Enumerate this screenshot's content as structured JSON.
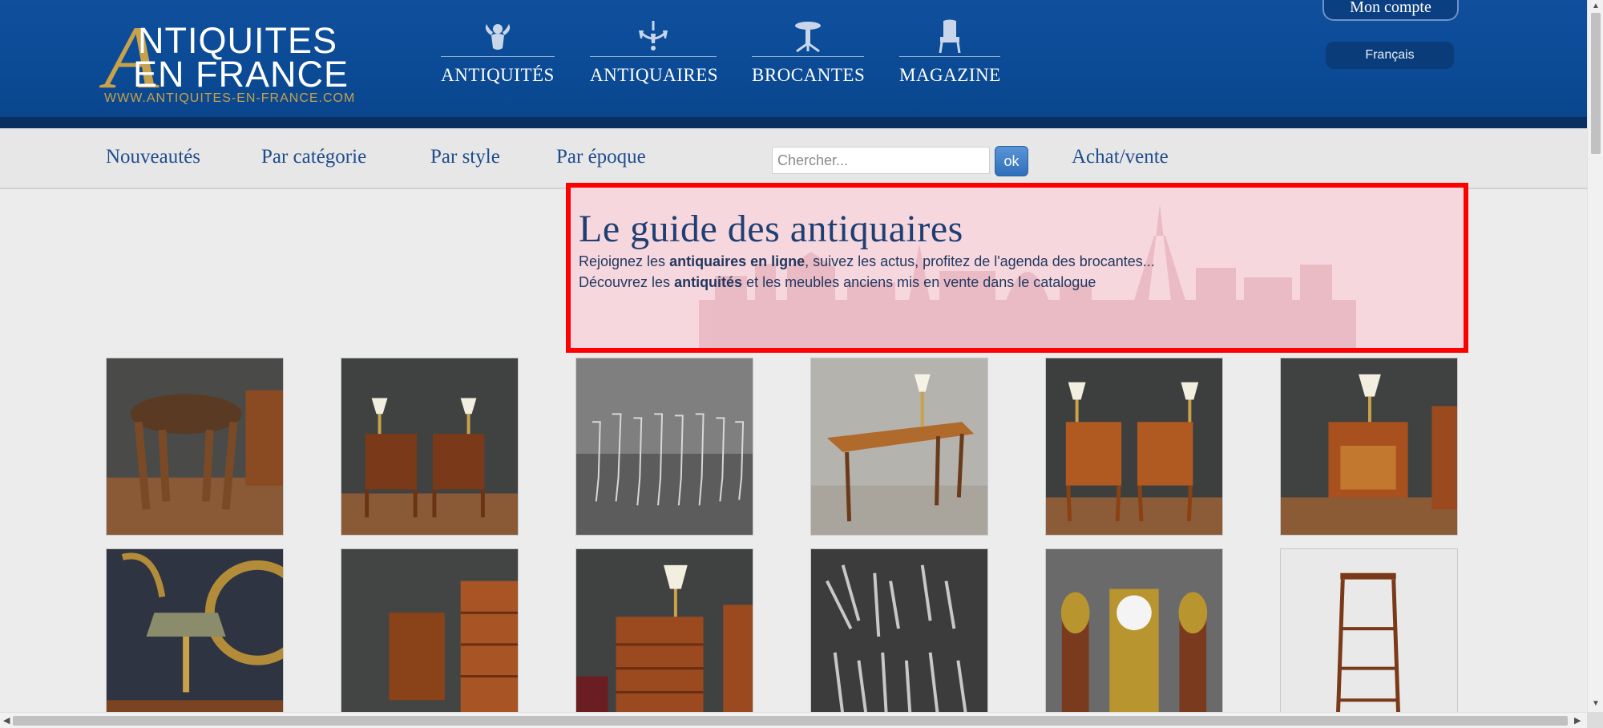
{
  "logo": {
    "line1": "NTIQUITES",
    "line2": "EN FRANCE",
    "big_letter": "A",
    "url": "WWW.ANTIQUITES-EN-FRANCE.COM"
  },
  "main_nav": [
    {
      "label": "ANTIQUITÉS",
      "icon": "cherub-icon"
    },
    {
      "label": "ANTIQUAIRES",
      "icon": "chandelier-icon"
    },
    {
      "label": "BROCANTES",
      "icon": "pedestal-table-icon"
    },
    {
      "label": "MAGAZINE",
      "icon": "armchair-icon"
    }
  ],
  "account": {
    "label": "Mon compte"
  },
  "language": {
    "label": "Français"
  },
  "subnav": [
    {
      "label": "Nouveautés"
    },
    {
      "label": "Par catégorie"
    },
    {
      "label": "Par style"
    },
    {
      "label": "Par époque"
    }
  ],
  "search": {
    "placeholder": "Chercher...",
    "value": "",
    "button": "ok"
  },
  "buy_sell": {
    "label": "Achat/vente"
  },
  "hero": {
    "title": "Le guide des antiquaires",
    "line1_pre": "Rejoignez les ",
    "line1_bold": "antiquaires en ligne",
    "line1_post": ", suivez les actus, profitez de l'agenda des brocantes...",
    "line2_pre": "Découvrez les ",
    "line2_bold": "antiquités",
    "line2_post": " et les meubles anciens mis en vente dans le catalogue"
  },
  "colors": {
    "header_blue": "#0b4a95",
    "gold": "#c7a24a",
    "subnav_text": "#1f4d8c",
    "highlight_border": "#ff0000"
  },
  "products": [
    {
      "subject": "stool"
    },
    {
      "subject": "pair-of-bedside-tables"
    },
    {
      "subject": "crystal-glasses"
    },
    {
      "subject": "writing-desk"
    },
    {
      "subject": "pair-of-nightstands"
    },
    {
      "subject": "marquetry-table"
    },
    {
      "subject": "bouillotte-lamp"
    },
    {
      "subject": "small-side-table"
    },
    {
      "subject": "chest-of-drawers"
    },
    {
      "subject": "silverware-set"
    },
    {
      "subject": "clock-garniture"
    },
    {
      "subject": "shelf-stand"
    }
  ]
}
